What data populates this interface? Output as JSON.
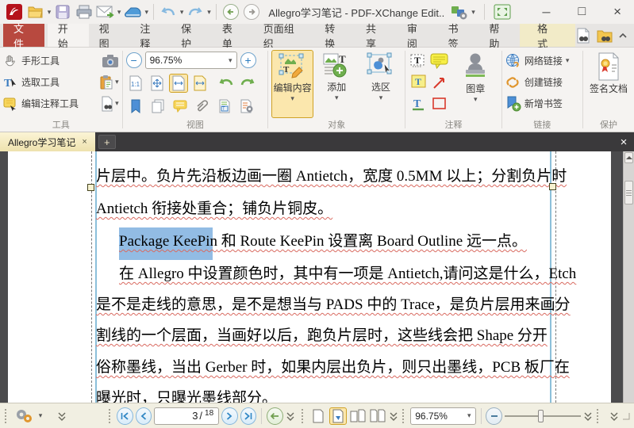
{
  "titlebar": {
    "title": "Allegro学习笔记 - PDF-XChange Edit.."
  },
  "icons": {
    "dropdown": "▾",
    "minimize": "─",
    "maximize": "□",
    "close": "×",
    "plus": "+",
    "slash": "/"
  },
  "ribbon_tabs": [
    "文件",
    "开始",
    "视图",
    "注释",
    "保护",
    "表单",
    "页面组织",
    "转换",
    "共享",
    "审阅",
    "书签",
    "帮助",
    "格式"
  ],
  "ribbon": {
    "tools": {
      "label": "工具",
      "hand": "手形工具",
      "select": "选取工具",
      "edit_comment": "编辑注释工具"
    },
    "view": {
      "label": "视图",
      "zoom_value": "96.75%"
    },
    "object": {
      "label": "对象",
      "edit_content": "编辑内容",
      "add": "添加",
      "selection": "选区"
    },
    "comment": {
      "label": "注释",
      "stamp": "图章"
    },
    "links": {
      "label": "链接",
      "web_links": "网络链接",
      "create_link": "创建链接",
      "add_bookmark": "新增书签"
    },
    "protect": {
      "label": "保护",
      "sign": "签名文档"
    }
  },
  "document_tab": {
    "title": "Allegro学习笔记"
  },
  "document": {
    "line1": "片层中。负片先沿板边画一圈 Antietch，宽度 0.5MM 以上；分割负片时",
    "line2": "Antietch 衔接处重合；铺负片铜皮。",
    "line3_selected": "Package KeePin",
    "line3_rest": " 和 Route KeePin 设置离 Board Outline 远一点。",
    "line4": "在 Allegro 中设置颜色时，其中有一项是 Antietch,请问这是什么，Etch",
    "line5": "是不是走线的意思，是不是想当与 PADS 中的 Trace，是负片层用来画分",
    "line6": "割线的一个层面，当画好以后，跑负片层时，这些线会把 Shape 分开",
    "line7": "俗称墨线，当出 Gerber 时，如果内层出负片，则只出墨线，PCB 板厂在",
    "line8": "曝光时，只曝光墨线部分。"
  },
  "statusbar": {
    "page_current": "3",
    "page_total": "18",
    "zoom_value": "96.75%"
  }
}
